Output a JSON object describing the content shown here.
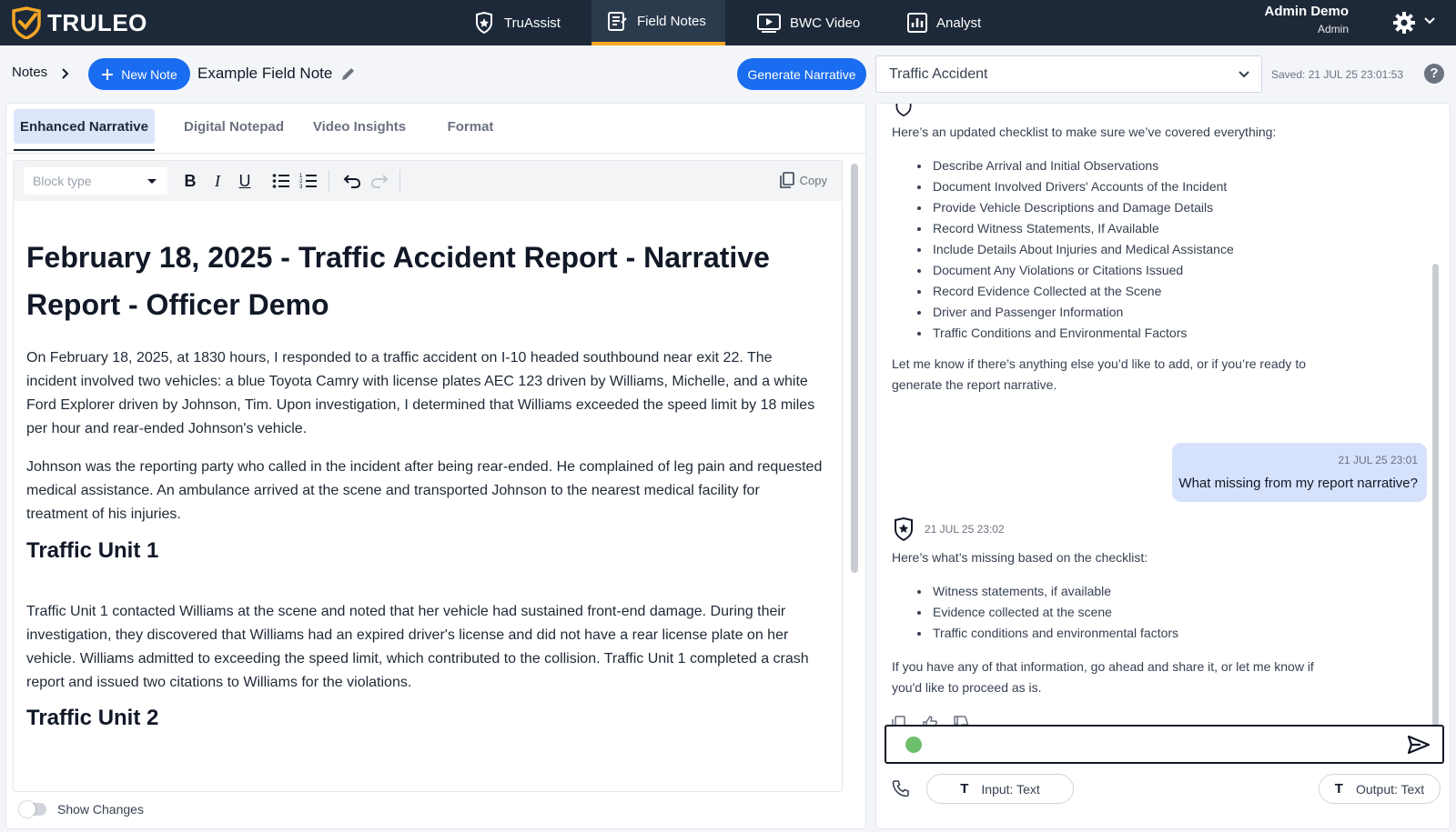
{
  "app": {
    "logo_text": "TRULEO"
  },
  "nav": {
    "tabs": [
      {
        "label": "TruAssist",
        "icon": "shield-badge-icon"
      },
      {
        "label": "Field Notes",
        "icon": "notepad-icon",
        "active": true
      },
      {
        "label": "BWC Video",
        "icon": "video-player-icon"
      },
      {
        "label": "Analyst",
        "icon": "bar-chart-icon"
      }
    ],
    "user_name": "Admin Demo",
    "user_role": "Admin"
  },
  "subheader": {
    "breadcrumb": "Notes",
    "new_note_label": "New Note",
    "note_title": "Example Field Note",
    "generate_label": "Generate Narrative",
    "incident_type": "Traffic Accident",
    "saved_text": "Saved: 21 JUL 25 23:01:53",
    "help_label": "?"
  },
  "editor": {
    "tabs": [
      "Enhanced Narrative",
      "Digital Notepad",
      "Video Insights",
      "Format"
    ],
    "active_tab": "Enhanced Narrative",
    "block_type_placeholder": "Block type",
    "toolbar": {
      "bold": "B",
      "italic": "I",
      "underline": "U",
      "copy_label": "Copy"
    },
    "title": "February 18, 2025 - Traffic Accident Report - Narrative Report - Officer Demo",
    "paragraphs": [
      "On February 18, 2025, at 1830 hours, I responded to a traffic accident on I-10 headed southbound near exit 22. The incident involved two vehicles: a blue Toyota Camry with license plates AEC 123 driven by Williams, Michelle, and a white Ford Explorer driven by Johnson, Tim. Upon investigation, I determined that Williams exceeded the speed limit by 18 miles per hour and rear-ended Johnson's vehicle.",
      "Johnson was the reporting party who called in the incident after being rear-ended. He complained of leg pain and requested medical assistance. An ambulance arrived at the scene and transported Johnson to the nearest medical facility for treatment of his injuries.",
      "Traffic Unit 1 contacted Williams at the scene and noted that her vehicle had sustained front-end damage. During their investigation, they discovered that Williams had an expired driver's license and did not have a rear license plate on her vehicle. Williams admitted to exceeding the speed limit, which contributed to the collision. Traffic Unit 1 completed a crash report and issued two citations to Williams for the violations."
    ],
    "heading_unit1": "Traffic Unit 1",
    "heading_unit2": "Traffic Unit 2",
    "show_changes_label": "Show Changes"
  },
  "chat": {
    "intro": "Here’s an updated checklist to make sure we’ve covered everything:",
    "checklist": [
      "Describe Arrival and Initial Observations",
      "Document Involved Drivers' Accounts of the Incident",
      "Provide Vehicle Descriptions and Damage Details",
      "Record Witness Statements, If Available",
      "Include Details About Injuries and Medical Assistance",
      "Document Any Violations or Citations Issued",
      "Record Evidence Collected at the Scene",
      "Driver and Passenger Information",
      "Traffic Conditions and Environmental Factors"
    ],
    "followup": "Let me know if there’s anything else you’d like to add, or if you’re ready to generate the report narrative.",
    "user_timestamp": "21 JUL 25 23:01",
    "user_message": "What missing from my report narrative?",
    "bot_timestamp": "21 JUL 25 23:02",
    "missing_intro": "Here’s what’s missing based on the checklist:",
    "missing_items": [
      "Witness statements, if available",
      "Evidence collected at the scene",
      "Traffic conditions and environmental factors"
    ],
    "closing": "If you have any of that information, go ahead and share it, or let me know if you'd like to proceed as is.",
    "input_mode_label": "Input: Text",
    "output_mode_label": "Output: Text"
  },
  "colors": {
    "nav_bg": "#1d2939",
    "accent_orange": "#f5a623",
    "primary_blue": "#1a6cf0",
    "user_bubble": "#d6e2fb",
    "mic_green": "#6dbf6d"
  }
}
